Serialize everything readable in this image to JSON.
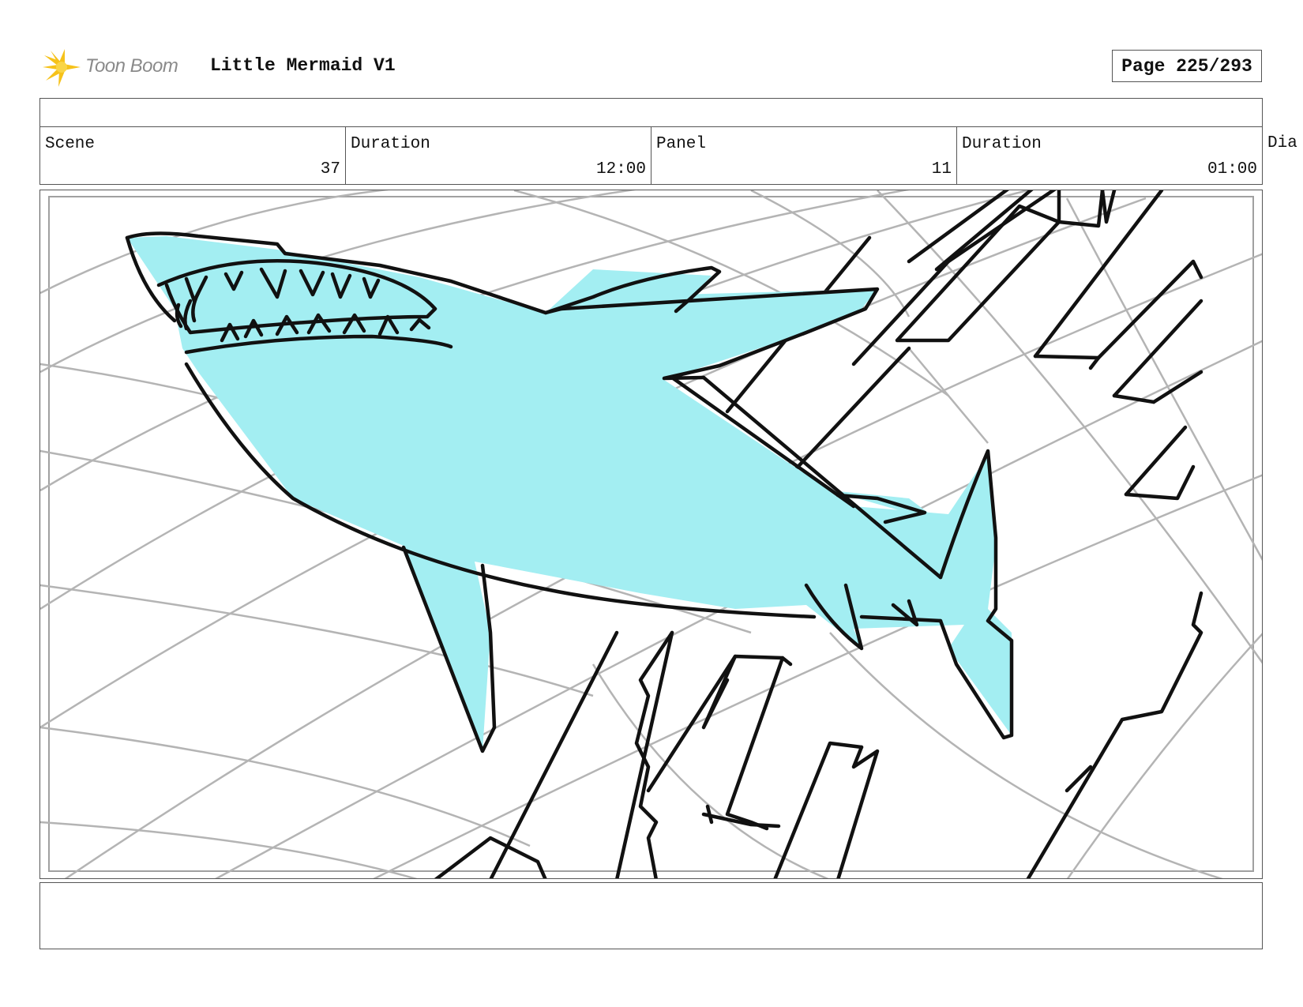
{
  "header": {
    "logo_text": "Toon Boom",
    "project_title": "Little Mermaid V1",
    "page_label": "Page 225/293"
  },
  "info": {
    "scene_label": "Scene",
    "scene_value": "37",
    "scene_duration_label": "Duration",
    "scene_duration_value": "12:00",
    "panel_label": "Panel",
    "panel_value": "11",
    "panel_duration_label": "Duration",
    "panel_duration_value": "01:00",
    "dialogue_label": "Dia"
  },
  "colors": {
    "shark_fill": "#a3eef2",
    "line": "#111111",
    "grid": "#b4b4b4"
  }
}
